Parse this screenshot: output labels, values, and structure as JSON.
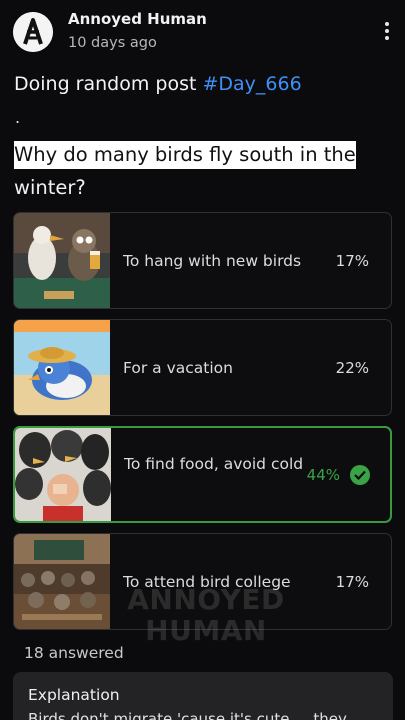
{
  "post": {
    "author": "Annoyed Human",
    "time": "10 days ago",
    "text_prefix": "Doing random post ",
    "hashtag": "#Day_666",
    "dot": ".",
    "question_part1": "Why do many birds fly south in the",
    "question_part2": "winter?"
  },
  "poll": {
    "options": [
      {
        "label": "To hang with new birds",
        "percent": "17%",
        "thumb": "birds-at-bar"
      },
      {
        "label": "For a vacation",
        "percent": "22%",
        "thumb": "bird-on-beach"
      },
      {
        "label": "To find food, avoid cold",
        "percent": "44%",
        "thumb": "crowd-of-birds",
        "correct": true
      },
      {
        "label": "To attend bird college",
        "percent": "17%",
        "thumb": "bird-classroom"
      }
    ],
    "answered": "18 answered"
  },
  "watermark": {
    "line1": "ANNOYED",
    "line2": "HUMAN"
  },
  "explanation": {
    "title": "Explanation",
    "body": "Birds don't migrate 'cause it's cute ... they"
  },
  "colors": {
    "background": "#0b0b0d",
    "hashtag": "#3f8ff7",
    "correct": "#3aa345"
  }
}
